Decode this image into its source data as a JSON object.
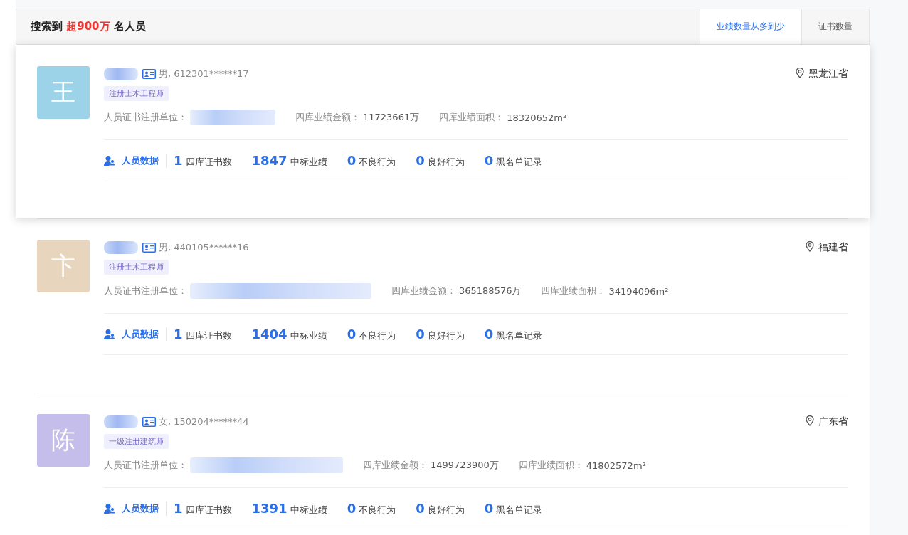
{
  "header": {
    "prefix": "搜索到",
    "count": "超900万",
    "suffix": "名人员"
  },
  "sort_tabs": [
    {
      "label": "业绩数量从多到少",
      "selected": true
    },
    {
      "label": "证书数量",
      "selected": false
    }
  ],
  "people": [
    {
      "avatar": "王",
      "color": "#9dd3e8",
      "highlighted": true,
      "gender_id": "男, 612301******17",
      "tag": "注册土木工程师",
      "location": "黑龙江省",
      "fields": [
        {
          "label": "人员证书注册单位：",
          "kind": "redacted"
        },
        {
          "label": "四库业绩金额：",
          "value": "11723661万",
          "kind": "text"
        },
        {
          "label": "四库业绩面积：",
          "value": "18320652m²",
          "kind": "text"
        }
      ],
      "data_link": "人员数据",
      "stats": [
        {
          "value": "1",
          "label": "四库证书数"
        },
        {
          "value": "1847",
          "label": "中标业绩"
        },
        {
          "value": "0",
          "label": "不良行为"
        },
        {
          "value": "0",
          "label": "良好行为"
        },
        {
          "value": "0",
          "label": "黑名单记录"
        }
      ]
    },
    {
      "avatar": "卞",
      "color": "#e8d5bd",
      "highlighted": false,
      "gender_id": "男, 440105******16",
      "tag": "注册土木工程师",
      "location": "福建省",
      "fields": [
        {
          "label": "人员证书注册单位：",
          "kind": "redacted_long"
        },
        {
          "label": "四库业绩金额：",
          "value": "365188576万",
          "kind": "text"
        },
        {
          "label": "四库业绩面积：",
          "value": "34194096m²",
          "kind": "text"
        }
      ],
      "data_link": "人员数据",
      "stats": [
        {
          "value": "1",
          "label": "四库证书数"
        },
        {
          "value": "1404",
          "label": "中标业绩"
        },
        {
          "value": "0",
          "label": "不良行为"
        },
        {
          "value": "0",
          "label": "良好行为"
        },
        {
          "value": "0",
          "label": "黑名单记录"
        }
      ]
    },
    {
      "avatar": "陈",
      "color": "#c5bdea",
      "highlighted": false,
      "gender_id": "女, 150204******44",
      "tag": "一级注册建筑师",
      "location": "广东省",
      "fields": [
        {
          "label": "人员证书注册单位：",
          "kind": "redacted_mid"
        },
        {
          "label": "四库业绩金额：",
          "value": "1499723900万",
          "kind": "text"
        },
        {
          "label": "四库业绩面积：",
          "value": "41802572m²",
          "kind": "text"
        }
      ],
      "data_link": "人员数据",
      "stats": [
        {
          "value": "1",
          "label": "四库证书数"
        },
        {
          "value": "1391",
          "label": "中标业绩"
        },
        {
          "value": "0",
          "label": "不良行为"
        },
        {
          "value": "0",
          "label": "良好行为"
        },
        {
          "value": "0",
          "label": "黑名单记录"
        }
      ]
    }
  ]
}
